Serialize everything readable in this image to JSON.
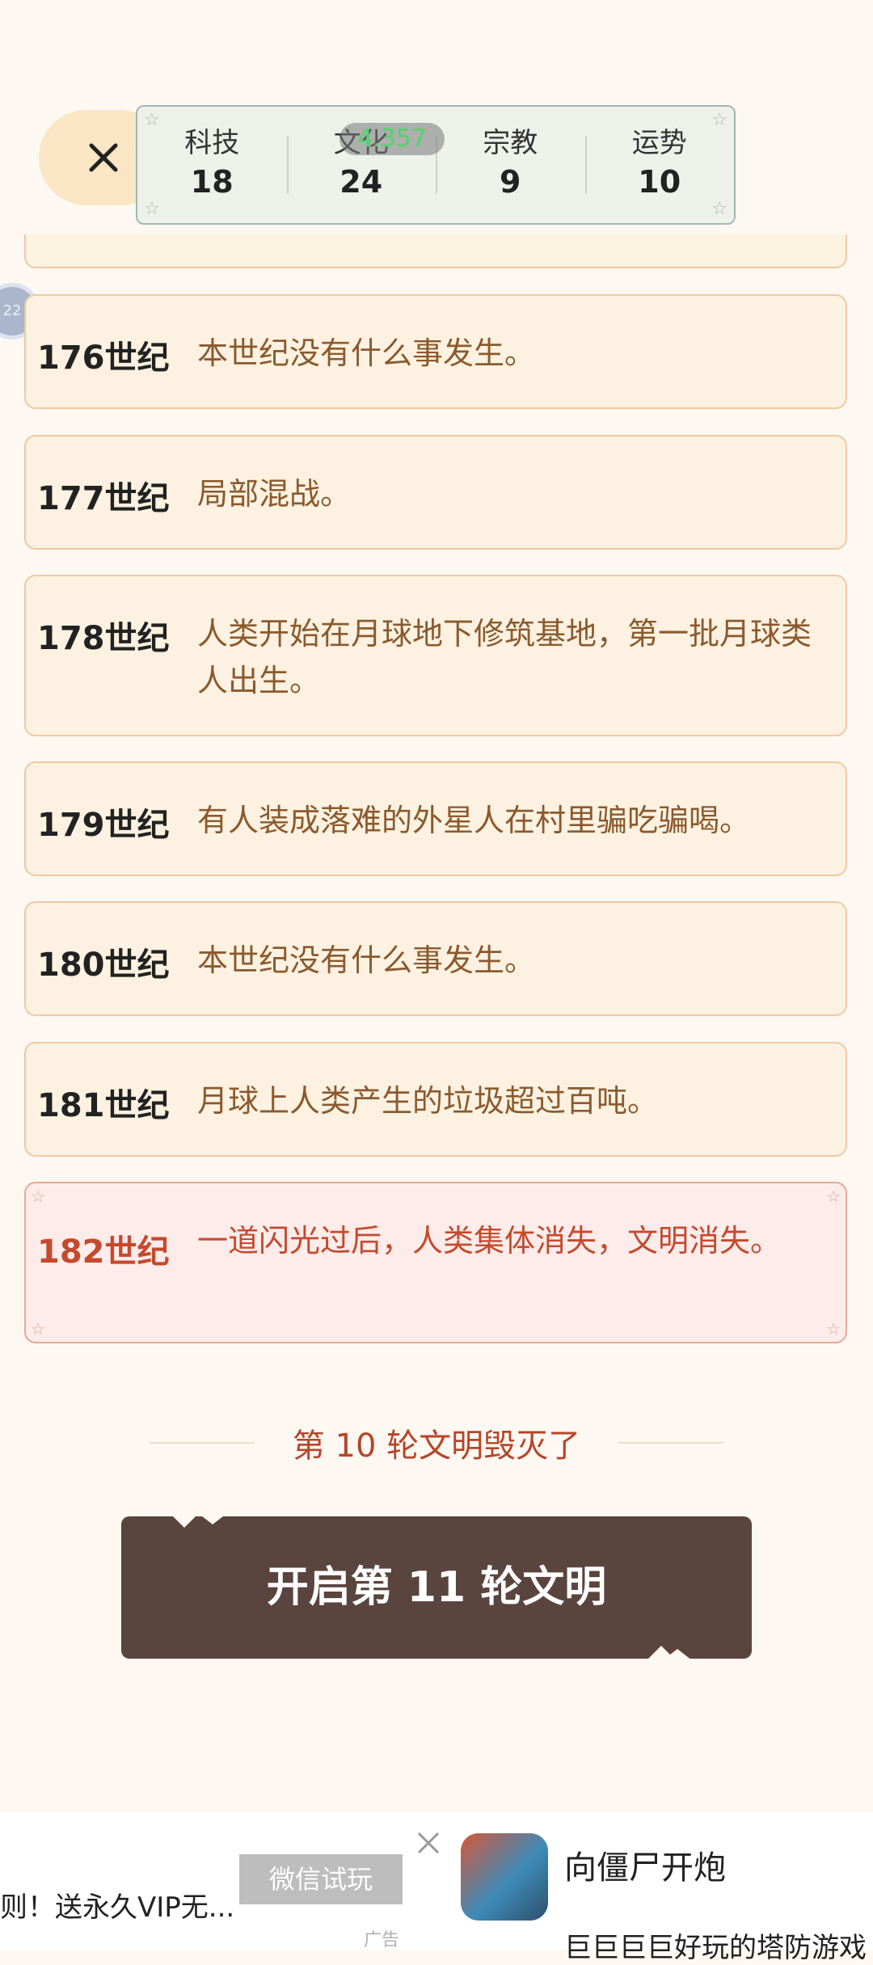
{
  "close_label": "×",
  "stats": [
    {
      "label": "科技",
      "value": "18"
    },
    {
      "label": "文化",
      "value": "24"
    },
    {
      "label": "宗教",
      "value": "9"
    },
    {
      "label": "运势",
      "value": "10"
    }
  ],
  "overlay_counter": "4.357",
  "side_badge": "22",
  "events": [
    {
      "century": "176世纪",
      "text": "本世纪没有什么事发生。"
    },
    {
      "century": "177世纪",
      "text": "局部混战。"
    },
    {
      "century": "178世纪",
      "text": "人类开始在月球地下修筑基地，第一批月球类人出生。"
    },
    {
      "century": "179世纪",
      "text": "有人装成落难的外星人在村里骗吃骗喝。"
    },
    {
      "century": "180世纪",
      "text": "本世纪没有什么事发生。"
    },
    {
      "century": "181世纪",
      "text": "月球上人类产生的垃圾超过百吨。"
    },
    {
      "century": "182世纪",
      "text": "一道闪光过后，人类集体消失，文明消失。"
    }
  ],
  "summary": "第 10 轮文明毁灭了",
  "start_button": "开启第 11 轮文明",
  "ad": {
    "text": "则！送永久VIP无...",
    "trial_button": "微信试玩",
    "label": "广告",
    "title": "向僵尸开炮",
    "subtitle": "巨巨巨巨好玩的塔防游戏"
  },
  "colors": {
    "background": "#fdf8f1",
    "card": "#fdf2e1",
    "final_card": "#fdecea",
    "accent_red": "#c44a2e",
    "button": "#5a443e"
  }
}
